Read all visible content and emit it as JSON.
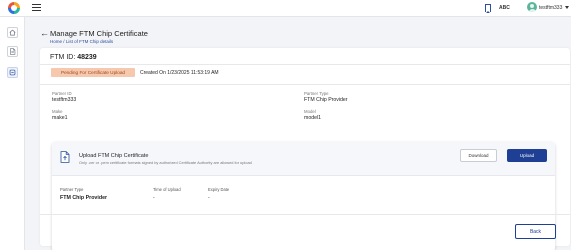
{
  "header": {
    "partner_abbr": "ABC",
    "username": "testftm333"
  },
  "sidebar": {
    "items": [
      {
        "name": "home",
        "icon": "home-icon"
      },
      {
        "name": "documents",
        "icon": "document-icon"
      },
      {
        "name": "certificates",
        "icon": "certificate-icon",
        "active": true
      }
    ]
  },
  "page": {
    "title": "Manage FTM Chip Certificate",
    "breadcrumb": {
      "home": "Home",
      "separator": "/",
      "current": "List of FTM Chip details"
    }
  },
  "ftm": {
    "id_label": "FTM ID:",
    "id_value": "48239",
    "status": "Pending For Certificate Upload",
    "created_on": "Created On 1/23/2025   11:53:19 AM",
    "partner_id_label": "Partner ID",
    "partner_id_value": "testftm333",
    "partner_type_label": "Partner Type",
    "partner_type_value": "FTM Chip Provider",
    "make_label": "Make",
    "make_value": "make1",
    "model_label": "Model",
    "model_value": "model1"
  },
  "upload": {
    "title": "Upload FTM Chip Certificate",
    "description": "Only .cer or .pem certificate formats signed by authorized Certificate Authority are allowed for upload",
    "download_label": "Download",
    "upload_label": "Upload",
    "columns": {
      "partner_type": "Partner Type",
      "time_of_upload": "Time of Upload",
      "expiry_date": "Expiry Date"
    },
    "values": {
      "partner_type": "FTM Chip Provider",
      "time_of_upload": "-",
      "expiry_date": "-"
    }
  },
  "footer": {
    "back_label": "Back"
  },
  "colors": {
    "primary": "#1f3f94",
    "status_bg": "#f6c9ae",
    "status_text": "#a2461a"
  }
}
